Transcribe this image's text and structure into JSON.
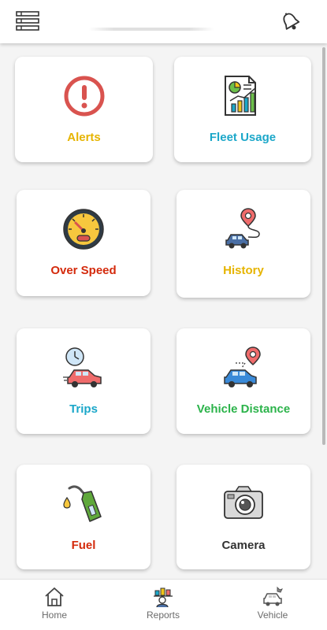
{
  "header": {
    "menu_icon": "menu-list-icon",
    "notification_icon": "bell-icon"
  },
  "dashboard": {
    "tiles": [
      {
        "label": "Alerts",
        "icon": "alert-icon",
        "color": "#e6b400"
      },
      {
        "label": "Fleet Usage",
        "icon": "report-chart-icon",
        "color": "#1ba7c9"
      },
      {
        "label": "Over Speed",
        "icon": "speedometer-icon",
        "color": "#d42a0c"
      },
      {
        "label": "History",
        "icon": "route-history-icon",
        "color": "#e6b400"
      },
      {
        "label": "Trips",
        "icon": "clock-car-icon",
        "color": "#1ba7c9"
      },
      {
        "label": "Vehicle Distance",
        "icon": "car-location-icon",
        "color": "#2bb34a"
      },
      {
        "label": "Fuel",
        "icon": "fuel-nozzle-icon",
        "color": "#d42a0c"
      },
      {
        "label": "Camera",
        "icon": "camera-icon",
        "color": "#333333"
      }
    ]
  },
  "bottom_nav": {
    "items": [
      {
        "label": "Home",
        "icon": "home-icon"
      },
      {
        "label": "Reports",
        "icon": "reports-icon"
      },
      {
        "label": "Vehicle",
        "icon": "vehicle-settings-icon"
      }
    ]
  }
}
